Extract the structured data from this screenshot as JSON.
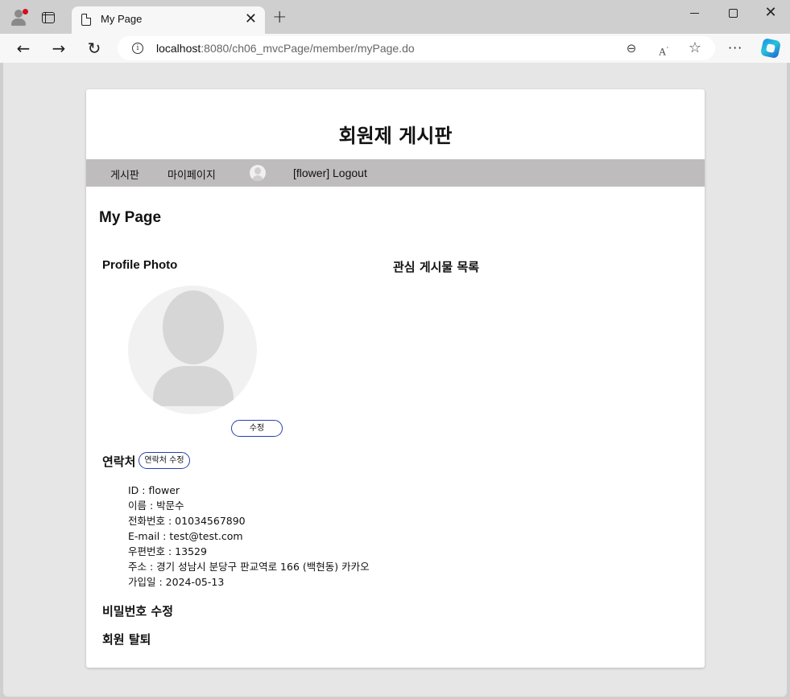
{
  "browser": {
    "tab_title": "My Page",
    "url_host": "localhost",
    "url_rest": ":8080/ch06_mvcPage/member/myPage.do",
    "icons": [
      "profile-icon",
      "tabs-icon",
      "page-icon",
      "close-icon",
      "plus-icon",
      "back-arrow-icon",
      "forward-arrow-icon",
      "reload-icon",
      "info-icon",
      "zoom-out-icon",
      "read-aloud-icon",
      "favorite-star-icon",
      "more-icon",
      "copilot-icon"
    ]
  },
  "site": {
    "title": "회원제 게시판",
    "menu": {
      "board": "게시판",
      "mypage": "마이페이지",
      "user_logout": "[flower] Logout"
    }
  },
  "page": {
    "heading": "My Page",
    "profile_photo_title": "Profile Photo",
    "favorites_title": "관심 게시물 목록",
    "photo_edit_button": "수정",
    "contact_title": "연락처",
    "contact_edit_button": "연락처 수정",
    "contact": [
      "ID : flower",
      "이름 : 박문수",
      "전화번호 : 01034567890",
      "E-mail : test@test.com",
      "우편번호 : 13529",
      "주소 : 경기 성남시 분당구 판교역로 166 (백현동) 카카오",
      "가입일 : 2024-05-13"
    ],
    "password_change_title": "비밀번호 수정",
    "withdraw_title": "회원 탈퇴"
  }
}
